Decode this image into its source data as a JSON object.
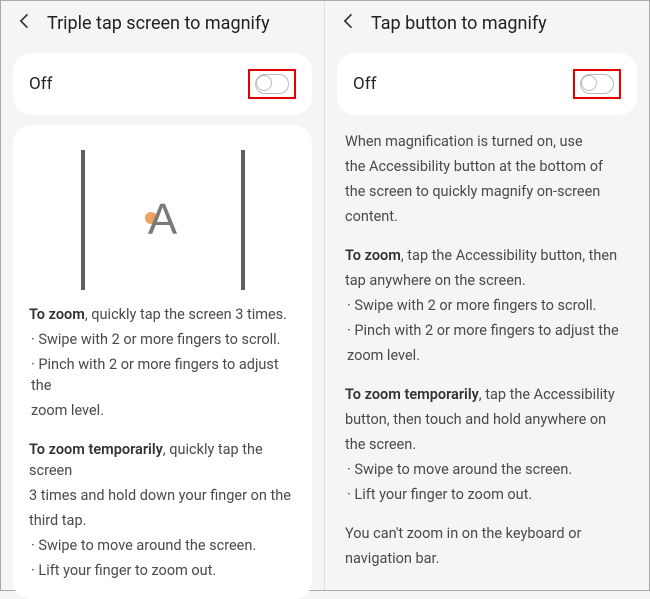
{
  "left": {
    "title": "Triple tap screen to magnify",
    "toggle_label": "Off",
    "zoom_intro_bold": "To zoom",
    "zoom_intro_rest": ", quickly tap the screen 3 times.",
    "zoom_b1": "· Swipe with 2 or more fingers to scroll.",
    "zoom_b2a": "· Pinch with 2 or more fingers to adjust the",
    "zoom_b2b": "  zoom level.",
    "temp_bold": "To zoom temporarily",
    "temp_rest_a": ", quickly tap the screen",
    "temp_rest_b": "3 times and hold down your finger on the",
    "temp_rest_c": "third tap.",
    "temp_b1": "· Swipe to move around the screen.",
    "temp_b2": "· Lift your finger to zoom out."
  },
  "right": {
    "title": "Tap button to magnify",
    "toggle_label": "Off",
    "intro_a": "When magnification is turned on, use",
    "intro_b": "the Accessibility button at the bottom of",
    "intro_c": "the screen to quickly magnify on-screen",
    "intro_d": "content.",
    "zoom_bold": "To zoom",
    "zoom_rest_a": ", tap the Accessibility button, then",
    "zoom_rest_b": "tap anywhere on the screen.",
    "zoom_b1": "· Swipe with 2 or more fingers to scroll.",
    "zoom_b2a": "· Pinch with 2 or more fingers to adjust the",
    "zoom_b2b": "  zoom level.",
    "temp_bold": "To zoom temporarily",
    "temp_rest_a": ", tap the Accessibility",
    "temp_rest_b": "button, then touch and hold anywhere on",
    "temp_rest_c": "the screen.",
    "temp_b1": "· Swipe to move around the screen.",
    "temp_b2": "· Lift your finger to zoom out.",
    "foot_a": "You can't zoom in on the keyboard or",
    "foot_b": "navigation bar."
  }
}
